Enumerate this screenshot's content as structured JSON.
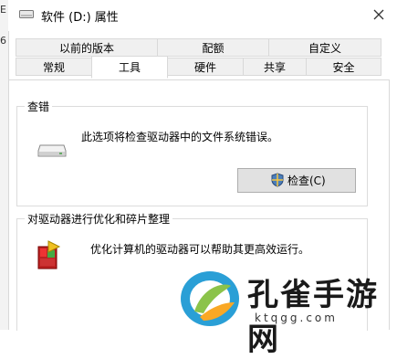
{
  "left_strip": {
    "chars": [
      "E",
      "6"
    ]
  },
  "window": {
    "title": "软件 (D:) 属性",
    "close_icon": "close-icon"
  },
  "tabs": {
    "row1": [
      {
        "label": "以前的版本"
      },
      {
        "label": "配额"
      },
      {
        "label": "自定义"
      }
    ],
    "row2": [
      {
        "label": "常规"
      },
      {
        "label": "工具",
        "active": true
      },
      {
        "label": "硬件"
      },
      {
        "label": "共享"
      },
      {
        "label": "安全"
      }
    ]
  },
  "check": {
    "group_label": "查错",
    "description": "此选项将检查驱动器中的文件系统错误。",
    "button_label": "检查(C)",
    "icon": "drive-icon",
    "button_icon": "shield-icon"
  },
  "optimize": {
    "group_label": "对驱动器进行优化和碎片整理",
    "description": "优化计算机的驱动器可以帮助其更高效运行。",
    "icon": "defrag-icon"
  },
  "watermark": {
    "text": "孔雀手游网",
    "url": "ktqgg.com"
  }
}
